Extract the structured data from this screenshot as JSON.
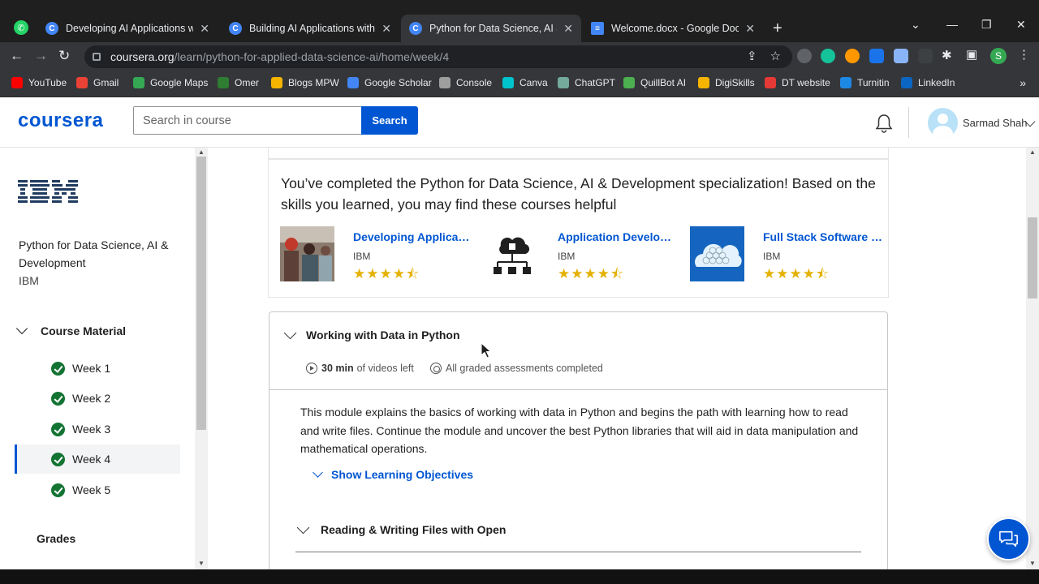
{
  "browser": {
    "tabs": [
      {
        "label": "Developing AI Applications with Python and Flask | Coursera",
        "active": false
      },
      {
        "label": "Building AI Applications with Watson APIs | Coursera",
        "active": false
      },
      {
        "label": "Python for Data Science, AI & Development | Coursera",
        "active": true
      },
      {
        "label": "Welcome.docx - Google Docs",
        "active": false
      }
    ],
    "url_host": "coursera.org",
    "url_path": "/learn/python-for-applied-data-science-ai/home/week/4",
    "bookmarks": [
      {
        "label": "YouTube",
        "color": "#ff0000"
      },
      {
        "label": "Gmail",
        "color": "#ea4335"
      },
      {
        "label": "Google Maps",
        "color": "#34a853"
      },
      {
        "label": "Omer",
        "color": "#2e7d32"
      },
      {
        "label": "Blogs MPW",
        "color": "#f4b400"
      },
      {
        "label": "Google Scholar",
        "color": "#4285f4"
      },
      {
        "label": "Console",
        "color": "#9e9e9e"
      },
      {
        "label": "Canva",
        "color": "#00c4cc"
      },
      {
        "label": "ChatGPT",
        "color": "#74aa9c"
      },
      {
        "label": "QuillBot AI",
        "color": "#4caf50"
      },
      {
        "label": "DigiSkills",
        "color": "#f4b400"
      },
      {
        "label": "DT website",
        "color": "#e53935"
      },
      {
        "label": "Turnitin",
        "color": "#1e88e5"
      },
      {
        "label": "LinkedIn",
        "color": "#0a66c2"
      }
    ],
    "profile_initial": "S"
  },
  "header": {
    "logo": "coursera",
    "search_placeholder": "Search in course",
    "search_button": "Search",
    "user_name": "Sarmad Shah"
  },
  "sidebar": {
    "org_logo": "IBM",
    "course_title": "Python for Data Science, AI & Development",
    "course_org": "IBM",
    "section_label": "Course Material",
    "weeks": [
      {
        "label": "Week 1",
        "completed": true,
        "active": false
      },
      {
        "label": "Week 2",
        "completed": true,
        "active": false
      },
      {
        "label": "Week 3",
        "completed": true,
        "active": false
      },
      {
        "label": "Week 4",
        "completed": true,
        "active": true
      },
      {
        "label": "Week 5",
        "completed": true,
        "active": false
      }
    ],
    "grades_label": "Grades"
  },
  "recommendations": {
    "message": "You’ve completed the Python for Data Science, AI & Development specialization! Based on the skills you learned, you may find these courses helpful",
    "courses": [
      {
        "name": "Developing Applications with SQL, Databases, and Django",
        "org": "IBM",
        "rating": 4.5
      },
      {
        "name": "Application Development using Microservices and Serverless",
        "org": "IBM",
        "rating": 4.5
      },
      {
        "name": "Full Stack Software Developer",
        "org": "IBM",
        "rating": 4.5
      }
    ]
  },
  "module": {
    "title": "Working with Data in Python",
    "videos_left_value": "30 min",
    "videos_left_suffix": "of videos left",
    "assessments": "All graded assessments completed",
    "description": "This module explains the basics of working with data in Python and begins the path with learning how to read and write files. Continue the module and uncover the best Python libraries that will aid in data manipulation and mathematical operations.",
    "objectives_link": "Show Learning Objectives",
    "lesson_title": "Reading & Writing Files with Open"
  },
  "colors": {
    "brand": "#0056d2",
    "success": "#137333",
    "star": "#e4b100"
  }
}
